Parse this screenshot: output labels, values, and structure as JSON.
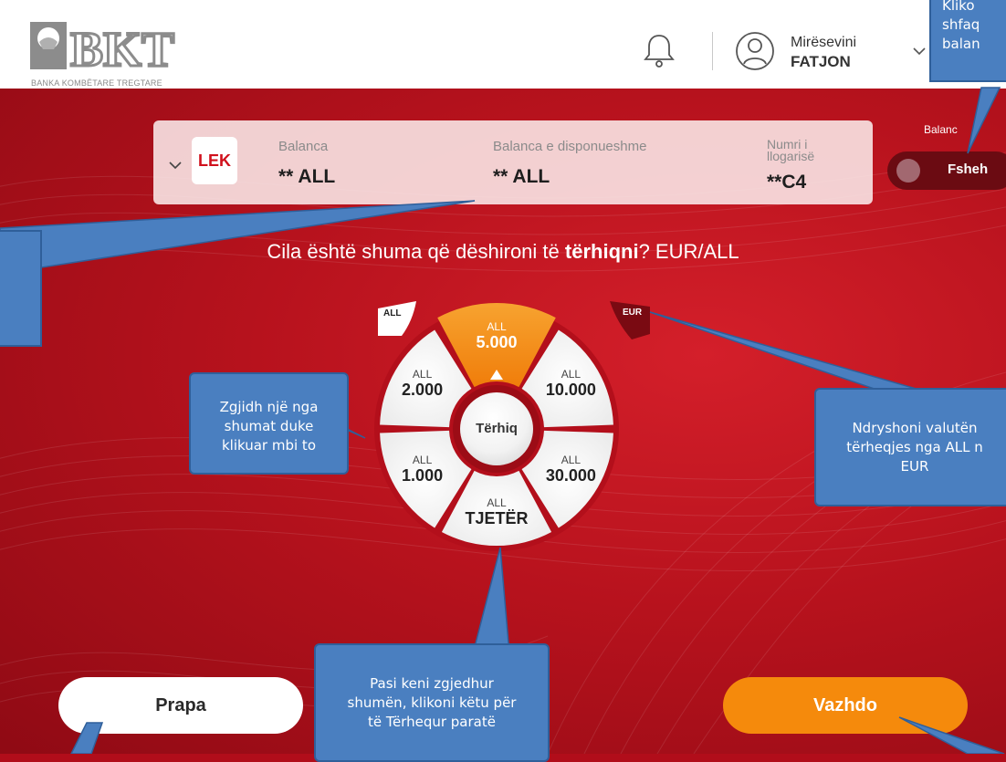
{
  "header": {
    "logo_text": "BKT",
    "bank_name": "BANKA KOMBËTARE TREGTARE",
    "greeting": "Mirësevini",
    "user_name": "FATJON"
  },
  "account": {
    "currency_badge": "LEK",
    "balance_label": "Balanca",
    "balance_value": "** ALL",
    "available_label": "Balanca e disponueshme",
    "available_value": "** ALL",
    "account_label_1": "Numri i",
    "account_label_2": "llogarisë",
    "account_value": "**C4"
  },
  "toggle": {
    "label": "Balanc",
    "state_text": "Fsheh"
  },
  "question": {
    "pre": "Cila është shuma që dëshironi të ",
    "bold": "tërhiqni",
    "post": "? EUR/ALL"
  },
  "wheel": {
    "badge_left": "ALL",
    "badge_right": "EUR",
    "center_label": "Tërhiq",
    "segments": [
      {
        "currency": "ALL",
        "amount": "5.000",
        "selected": true
      },
      {
        "currency": "ALL",
        "amount": "10.000",
        "selected": false
      },
      {
        "currency": "ALL",
        "amount": "30.000",
        "selected": false
      },
      {
        "currency": "ALL",
        "amount": "TJETËR",
        "selected": false
      },
      {
        "currency": "ALL",
        "amount": "1.000",
        "selected": false
      },
      {
        "currency": "ALL",
        "amount": "2.000",
        "selected": false
      }
    ]
  },
  "buttons": {
    "back": "Prapa",
    "continue": "Vazhdo"
  },
  "callouts": {
    "top_right": [
      "Kliko",
      "shfaq",
      "balan"
    ],
    "choose_amount": [
      "Zgjidh një nga",
      "shumat duke",
      "klikuar mbi to"
    ],
    "currency_change": [
      "Ndryshoni valutën",
      "tërheqjes nga ALL n",
      "EUR"
    ],
    "confirm": [
      "Pasi keni zgjedhur",
      "shumën, klikoni këtu për",
      "të Tërhequr paratë"
    ]
  },
  "colors": {
    "brand_red": "#c8101c",
    "accent_orange": "#f58a0c",
    "callout_blue": "#4a7fc0"
  }
}
